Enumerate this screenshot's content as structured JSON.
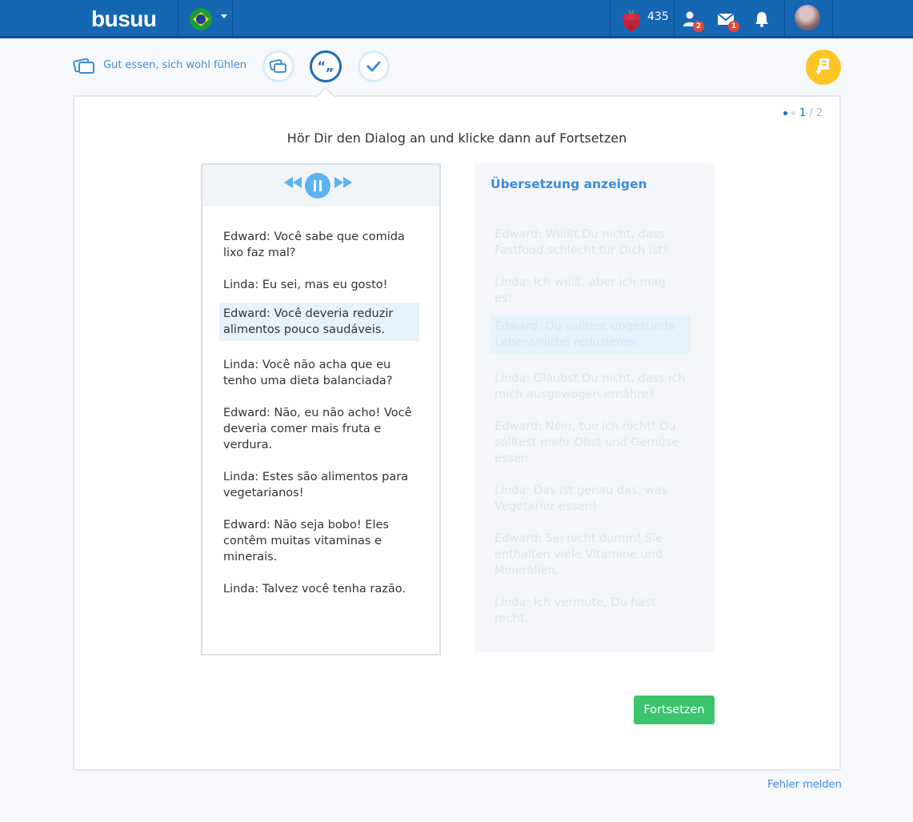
{
  "header": {
    "logo": "busuu",
    "points": "435",
    "friends_badge": "2",
    "messages_badge": "1",
    "icons": [
      "brazil-flag-icon",
      "dropdown-caret-icon",
      "berry-icon",
      "friend-requests-icon",
      "messages-icon",
      "notifications-icon",
      "avatar"
    ]
  },
  "lesson": {
    "title": "Gut essen, sich wohl fühlen",
    "steps": [
      "vocabulary-icon",
      "dialogue-icon",
      "quiz-check-icon"
    ],
    "pager_current": "1",
    "pager_total": "2"
  },
  "instruction": "Hör Dir den Dialog an und klicke dann auf Fortsetzen",
  "dialog": {
    "lines": [
      "Edward:  Você sabe que comida lixo faz mal?",
      "Linda:  Eu sei, mas eu gosto!",
      "Edward:  Você deveria reduzir alimentos pouco saudáveis.",
      "Linda:  Você não acha que eu tenho uma dieta balanciada?",
      "Edward:  Não, eu não acho! Você deveria comer mais fruta e verdura.",
      "Linda:  Estes são alimentos para vegetarianos!",
      "Edward:  Não seja bobo! Eles contêm muitas vitaminas e minerais.",
      "Linda:  Talvez você tenha razão."
    ],
    "highlighted_index": 2
  },
  "translation": {
    "title": "Übersetzung anzeigen",
    "lines": [
      "Edward:   Weißt Du nicht, dass Fastfood schlecht für Dich ist?",
      "Linda:   Ich weiß, aber ich mag es!",
      "Edward:   Du solltest ungesunde Lebensmittel reduzieren.",
      "Linda:   Glaubst Du nicht, dass ich mich ausgewogen ernähre?",
      "Edward:   Nein, tue ich nicht! Du solltest mehr Obst und Gemüse essen.",
      "Linda:   Das ist genau das, was Vegetarier essen!",
      "Edward:   Sei nicht dumm! Sie enthalten viele Vitamine und Mineralien.",
      "Linda:   Ich vermute, Du hast recht."
    ]
  },
  "buttons": {
    "continue": "Fortsetzen",
    "report_error": "Fehler melden"
  },
  "colors": {
    "brand_blue": "#1566b3",
    "link_blue": "#3d8bd6",
    "continue_green": "#3cc36e",
    "help_yellow": "#fcc524",
    "highlight": "#e4f3fd"
  }
}
